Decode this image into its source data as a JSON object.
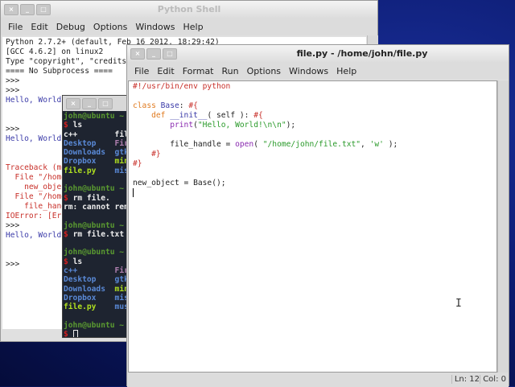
{
  "shell": {
    "title": "Python Shell",
    "menu": [
      "File",
      "Edit",
      "Debug",
      "Options",
      "Windows",
      "Help"
    ],
    "lines": [
      {
        "t": "Python 2.7.2+ (default, Feb 16 2012, 18:29:42)",
        "c": "blk"
      },
      {
        "t": "[GCC 4.6.2] on linux2",
        "c": "blk"
      },
      {
        "t": "Type \"copyright\", \"credits\"",
        "c": "blk"
      },
      {
        "t": "==== No Subprocess ====",
        "c": "blk"
      },
      {
        "t": ">>>",
        "c": "blk"
      },
      {
        "t": ">>>",
        "c": "blk"
      },
      {
        "t": "Hello, World",
        "c": "blue"
      },
      {
        "t": "",
        "c": "blk"
      },
      {
        "t": "",
        "c": "blk"
      },
      {
        "t": ">>>",
        "c": "blk"
      },
      {
        "t": "Hello, World",
        "c": "blue"
      },
      {
        "t": "",
        "c": "blk"
      },
      {
        "t": "",
        "c": "blk"
      },
      {
        "t": "Traceback (mo",
        "c": "red"
      },
      {
        "t": "  File \"/home",
        "c": "red"
      },
      {
        "t": "    new_objec",
        "c": "red"
      },
      {
        "t": "  File \"/home",
        "c": "red"
      },
      {
        "t": "    file_hand",
        "c": "red"
      },
      {
        "t": "IOError: [Err",
        "c": "red"
      },
      {
        "t": ">>>",
        "c": "blk"
      },
      {
        "t": "Hello, World",
        "c": "blue"
      },
      {
        "t": "",
        "c": "blk"
      },
      {
        "t": "",
        "c": "blk"
      },
      {
        "t": ">>>",
        "c": "blk"
      }
    ]
  },
  "terminal": {
    "lines": [
      [
        [
          "john@ubuntu ~",
          "tg"
        ]
      ],
      [
        [
          "$ ",
          "tr"
        ],
        [
          "ls",
          "tw"
        ]
      ],
      [
        [
          "c++        ",
          "tw"
        ],
        [
          "fil",
          "tw"
        ]
      ],
      [
        [
          "Desktop    ",
          "tb"
        ],
        [
          "Fir",
          "tp"
        ]
      ],
      [
        [
          "Downloads  ",
          "tb"
        ],
        [
          "gtk",
          "tb"
        ]
      ],
      [
        [
          "Dropbox    ",
          "tb"
        ],
        [
          "min",
          "ty"
        ]
      ],
      [
        [
          "file.py    ",
          "ty"
        ],
        [
          "mis",
          "tb"
        ]
      ],
      [
        [
          "",
          ""
        ]
      ],
      [
        [
          "john@ubuntu ~",
          "tg"
        ]
      ],
      [
        [
          "$ ",
          "tr"
        ],
        [
          "rm file.",
          "tw"
        ]
      ],
      [
        [
          "rm: cannot rem",
          "tw"
        ]
      ],
      [
        [
          "",
          ""
        ]
      ],
      [
        [
          "john@ubuntu ~",
          "tg"
        ]
      ],
      [
        [
          "$ ",
          "tr"
        ],
        [
          "rm file.txt",
          "tw"
        ]
      ],
      [
        [
          "",
          ""
        ]
      ],
      [
        [
          "john@ubuntu ~",
          "tg"
        ]
      ],
      [
        [
          "$ ",
          "tr"
        ],
        [
          "ls",
          "tw"
        ]
      ],
      [
        [
          "c++        ",
          "tb"
        ],
        [
          "Fir",
          "tp"
        ]
      ],
      [
        [
          "Desktop    ",
          "tb"
        ],
        [
          "gtk",
          "tb"
        ]
      ],
      [
        [
          "Downloads  ",
          "tb"
        ],
        [
          "min",
          "ty"
        ]
      ],
      [
        [
          "Dropbox    ",
          "tb"
        ],
        [
          "mis",
          "tb"
        ]
      ],
      [
        [
          "file.py    ",
          "ty"
        ],
        [
          "mus",
          "tb"
        ]
      ],
      [
        [
          "",
          ""
        ]
      ],
      [
        [
          "john@ubuntu ~",
          "tg"
        ]
      ],
      [
        [
          "$ ",
          "tr"
        ]
      ]
    ]
  },
  "editor": {
    "title": "file.py - /home/john/file.py",
    "menu": [
      "File",
      "Edit",
      "Format",
      "Run",
      "Options",
      "Windows",
      "Help"
    ],
    "lines": [
      [
        [
          "#!/usr/bin/env python",
          "red"
        ]
      ],
      [],
      [
        [
          "class ",
          "orange"
        ],
        [
          "Base",
          "blue"
        ],
        [
          ": ",
          "blk"
        ],
        [
          "#{",
          "red"
        ]
      ],
      [
        [
          "    ",
          "blk"
        ],
        [
          "def ",
          "orange"
        ],
        [
          "__init__",
          "blue"
        ],
        [
          "( self ): ",
          "blk"
        ],
        [
          "#{",
          "red"
        ]
      ],
      [
        [
          "        ",
          "blk"
        ],
        [
          "print",
          "purple"
        ],
        [
          "(",
          "blk"
        ],
        [
          "\"Hello, World!\\n\\n\"",
          "green"
        ],
        [
          ");",
          "blk"
        ]
      ],
      [],
      [
        [
          "        file_handle = ",
          "blk"
        ],
        [
          "open",
          "purple"
        ],
        [
          "( ",
          "blk"
        ],
        [
          "\"/home/john/file.txt\"",
          "green"
        ],
        [
          ", ",
          "blk"
        ],
        [
          "'w'",
          "green"
        ],
        [
          " );",
          "blk"
        ]
      ],
      [
        [
          "    ",
          "blk"
        ],
        [
          "#}",
          "red"
        ]
      ],
      [
        [
          "#}",
          "red"
        ]
      ],
      [],
      [
        [
          "new_object = Base();",
          "blk"
        ]
      ]
    ],
    "status": {
      "line": "Ln: 12",
      "col": "Col: 0"
    }
  }
}
